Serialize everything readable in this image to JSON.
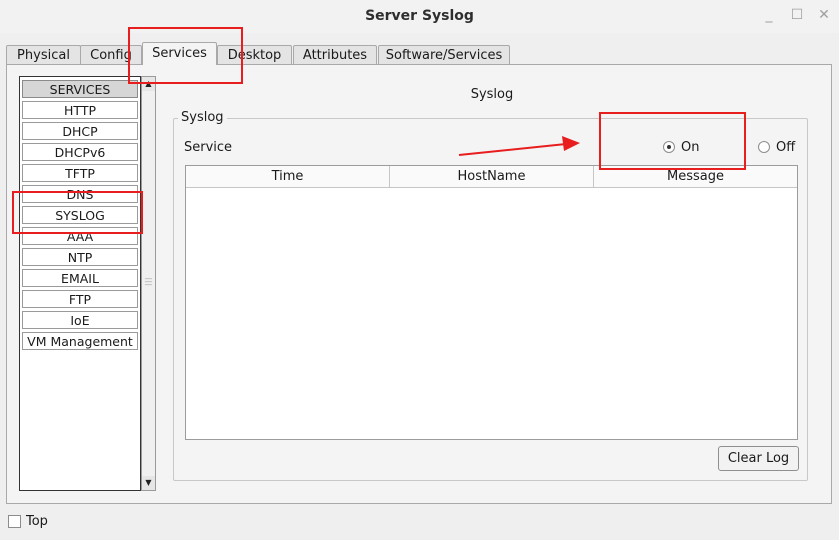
{
  "window": {
    "title": "Server Syslog"
  },
  "tabs": [
    {
      "label": "Physical"
    },
    {
      "label": "Config"
    },
    {
      "label": "Services",
      "active": true
    },
    {
      "label": "Desktop"
    },
    {
      "label": "Attributes"
    },
    {
      "label": "Software/Services"
    }
  ],
  "services_list": {
    "items": [
      "SERVICES",
      "HTTP",
      "DHCP",
      "DHCPv6",
      "TFTP",
      "DNS",
      "SYSLOG",
      "AAA",
      "NTP",
      "EMAIL",
      "FTP",
      "IoE",
      "VM Management"
    ]
  },
  "syslog": {
    "heading": "Syslog",
    "group_label": "Syslog",
    "service_label": "Service",
    "on_label": "On",
    "off_label": "Off",
    "selected": "On",
    "columns": [
      "Time",
      "HostName",
      "Message"
    ],
    "rows": [],
    "clear_button": "Clear Log"
  },
  "footer": {
    "top_label": "Top",
    "top_checked": false
  },
  "annotation_color": "#e81e1e"
}
